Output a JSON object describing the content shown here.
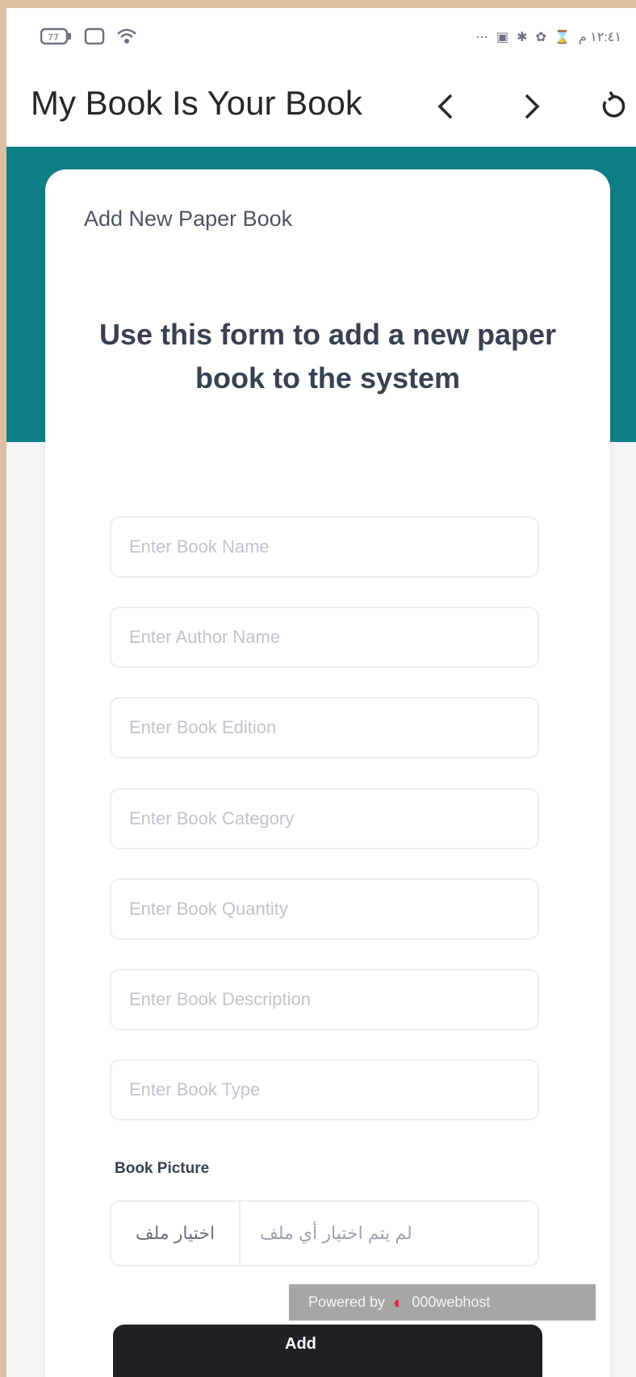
{
  "status_bar": {
    "left_icons": [
      "battery-indicator-icon",
      "sim-icon",
      "wifi-icon"
    ],
    "right_icons": [
      "more-icon",
      "notification-icon",
      "settings-icon",
      "alarm-icon",
      "timer-icon"
    ],
    "time": "١٢:٤١ م"
  },
  "app_bar": {
    "title": "My Book Is Your Book",
    "back_icon": "chevron-left-icon",
    "forward_icon": "chevron-right-icon",
    "reload_icon": "reload-icon"
  },
  "card": {
    "header": "Add New Paper Book",
    "subtitle": "Use this form to add a new paper book to the system"
  },
  "form": {
    "book_name_placeholder": "Enter Book Name",
    "author_name_placeholder": "Enter Author Name",
    "book_edition_placeholder": "Enter Book Edition",
    "book_category_placeholder": "Enter Book Category",
    "book_quantity_placeholder": "Enter Book Quantity",
    "book_description_placeholder": "Enter Book Description",
    "book_type_placeholder": "Enter Book Type",
    "picture_label": "Book Picture",
    "file_button": "اختيار ملف",
    "file_status": "لم يتم اختيار أي ملف",
    "submit_label": "Add"
  },
  "footer": {
    "powered_by": "Powered by",
    "host": "000webhost"
  },
  "colors": {
    "banner": "#0e7f85",
    "submit": "#1f2023",
    "background": "#f3f4f6"
  }
}
